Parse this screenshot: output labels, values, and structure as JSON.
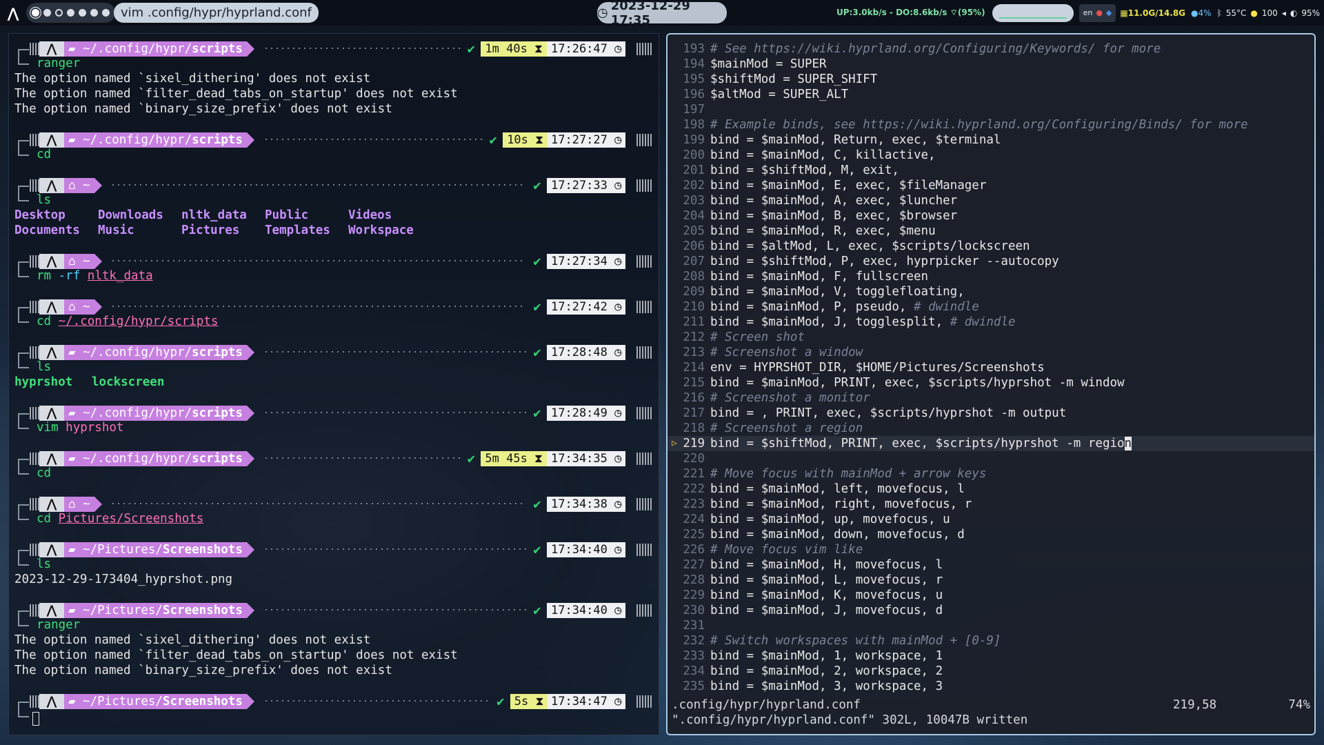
{
  "topbar": {
    "window_title": "vim .config/hypr/hyprland.conf",
    "clock": "2023-12-29 17:35",
    "network": "UP:3.0kb/s - DO:8.6kb/s",
    "wifi": "(95%)",
    "lang": "en",
    "memory": "11.0G/14.8G",
    "cpu": "4%",
    "temp": "55°C",
    "battery": "100",
    "volume": "95%",
    "accent_color": "#c680e0"
  },
  "left_terminal": {
    "blocks": [
      {
        "path_prefix": "~/.config/hypr/",
        "path_bold": "scripts",
        "duration": "1m 40s",
        "time": "17:26:47",
        "command": "ranger",
        "output": [
          "The option named `sixel_dithering' does not exist",
          "The option named `filter_dead_tabs_on_startup' does not exist",
          "The option named `binary_size_prefix' does not exist"
        ]
      },
      {
        "path_prefix": "~/.config/hypr/",
        "path_bold": "scripts",
        "duration": "10s",
        "time": "17:27:27",
        "command": "cd"
      },
      {
        "path_prefix": "~",
        "time": "17:27:33",
        "command": "ls",
        "ls": [
          "Desktop",
          "Downloads",
          "nltk_data",
          "Public",
          "Videos",
          "Documents",
          "Music",
          "Pictures",
          "Templates",
          "Workspace"
        ]
      },
      {
        "path_prefix": "~",
        "time": "17:27:34",
        "command": "rm",
        "flag": "-rf",
        "arg": "nltk_data"
      },
      {
        "path_prefix": "~",
        "time": "17:27:42",
        "command": "cd",
        "arg": "~/.config/hypr/scripts"
      },
      {
        "path_prefix": "~/.config/hypr/",
        "path_bold": "scripts",
        "time": "17:28:48",
        "command": "ls",
        "ls": [
          "hyprshot",
          "lockscreen"
        ]
      },
      {
        "path_prefix": "~/.config/hypr/",
        "path_bold": "scripts",
        "time": "17:28:49",
        "command": "vim",
        "arg": "hyprshot"
      },
      {
        "path_prefix": "~/.config/hypr/",
        "path_bold": "scripts",
        "duration": "5m 45s",
        "time": "17:34:35",
        "command": "cd"
      },
      {
        "path_prefix": "~",
        "time": "17:34:38",
        "command": "cd",
        "arg": "Pictures/Screenshots"
      },
      {
        "path_prefix": "~/Pictures/",
        "path_bold": "Screenshots",
        "time": "17:34:40",
        "command": "ls",
        "output": [
          "2023-12-29-173404_hyprshot.png"
        ]
      },
      {
        "path_prefix": "~/Pictures/",
        "path_bold": "Screenshots",
        "time": "17:34:40",
        "command": "ranger",
        "output": [
          "The option named `sixel_dithering' does not exist",
          "The option named `filter_dead_tabs_on_startup' does not exist",
          "The option named `binary_size_prefix' does not exist"
        ]
      },
      {
        "path_prefix": "~/Pictures/",
        "path_bold": "Screenshots",
        "duration": "5s",
        "time": "17:34:47"
      }
    ]
  },
  "vim": {
    "lines": [
      {
        "n": "193",
        "t": "# See https://wiki.hyprland.org/Configuring/Keywords/ for more",
        "c": true
      },
      {
        "n": "194",
        "t": "$mainMod = SUPER"
      },
      {
        "n": "195",
        "t": "$shiftMod = SUPER_SHIFT"
      },
      {
        "n": "196",
        "t": "$altMod = SUPER_ALT"
      },
      {
        "n": "197",
        "t": ""
      },
      {
        "n": "198",
        "t": "# Example binds, see https://wiki.hyprland.org/Configuring/Binds/ for more",
        "c": true
      },
      {
        "n": "199",
        "t": "bind = $mainMod, Return, exec, $terminal"
      },
      {
        "n": "200",
        "t": "bind = $mainMod, C, killactive,"
      },
      {
        "n": "201",
        "t": "bind = $shiftMod, M, exit,"
      },
      {
        "n": "202",
        "t": "bind = $mainMod, E, exec, $fileManager"
      },
      {
        "n": "203",
        "t": "bind = $mainMod, A, exec, $luncher"
      },
      {
        "n": "204",
        "t": "bind = $mainMod, B, exec, $browser"
      },
      {
        "n": "205",
        "t": "bind = $mainMod, R, exec, $menu"
      },
      {
        "n": "206",
        "t": "bind = $altMod, L, exec, $scripts/lockscreen"
      },
      {
        "n": "207",
        "t": "bind = $shiftMod, P, exec, hyprpicker --autocopy"
      },
      {
        "n": "208",
        "t": "bind = $mainMod, F, fullscreen"
      },
      {
        "n": "209",
        "t": "bind = $mainMod, V, togglefloating,"
      },
      {
        "n": "210",
        "t": "bind = $mainMod, P, pseudo, ",
        "tc": "# dwindle"
      },
      {
        "n": "211",
        "t": "bind = $mainMod, J, togglesplit, ",
        "tc": "# dwindle"
      },
      {
        "n": "212",
        "t": "# Screen shot",
        "c": true
      },
      {
        "n": "213",
        "t": "# Screenshot a window",
        "c": true
      },
      {
        "n": "214",
        "t": "env = HYPRSHOT_DIR, $HOME/Pictures/Screenshots"
      },
      {
        "n": "215",
        "t": "bind = $mainMod, PRINT, exec, $scripts/hyprshot -m window"
      },
      {
        "n": "216",
        "t": "# Screenshot a monitor",
        "c": true
      },
      {
        "n": "217",
        "t": "bind = , PRINT, exec, $scripts/hyprshot -m output"
      },
      {
        "n": "218",
        "t": "# Screenshot a region",
        "c": true
      },
      {
        "n": "219",
        "t": "bind = $shiftMod, PRINT, exec, $scripts/hyprshot -m regio",
        "cursor_char": "n",
        "cur": true
      },
      {
        "n": "220",
        "t": ""
      },
      {
        "n": "221",
        "t": "# Move focus with mainMod + arrow keys",
        "c": true
      },
      {
        "n": "222",
        "t": "bind = $mainMod, left, movefocus, l"
      },
      {
        "n": "223",
        "t": "bind = $mainMod, right, movefocus, r"
      },
      {
        "n": "224",
        "t": "bind = $mainMod, up, movefocus, u"
      },
      {
        "n": "225",
        "t": "bind = $mainMod, down, movefocus, d"
      },
      {
        "n": "226",
        "t": "# Move focus vim like",
        "c": true
      },
      {
        "n": "227",
        "t": "bind = $mainMod, H, movefocus, l"
      },
      {
        "n": "228",
        "t": "bind = $mainMod, L, movefocus, r"
      },
      {
        "n": "229",
        "t": "bind = $mainMod, K, movefocus, u"
      },
      {
        "n": "230",
        "t": "bind = $mainMod, J, movefocus, d"
      },
      {
        "n": "231",
        "t": ""
      },
      {
        "n": "232",
        "t": "# Switch workspaces with mainMod + [0-9]",
        "c": true
      },
      {
        "n": "233",
        "t": "bind = $mainMod, 1, workspace, 1"
      },
      {
        "n": "234",
        "t": "bind = $mainMod, 2, workspace, 2"
      },
      {
        "n": "235",
        "t": "bind = $mainMod, 3, workspace, 3"
      }
    ],
    "status_file": ".config/hypr/hyprland.conf",
    "status_pos": "219,58",
    "status_pct": "74%",
    "message": "\".config/hypr/hyprland.conf\" 302L, 10047B written"
  }
}
